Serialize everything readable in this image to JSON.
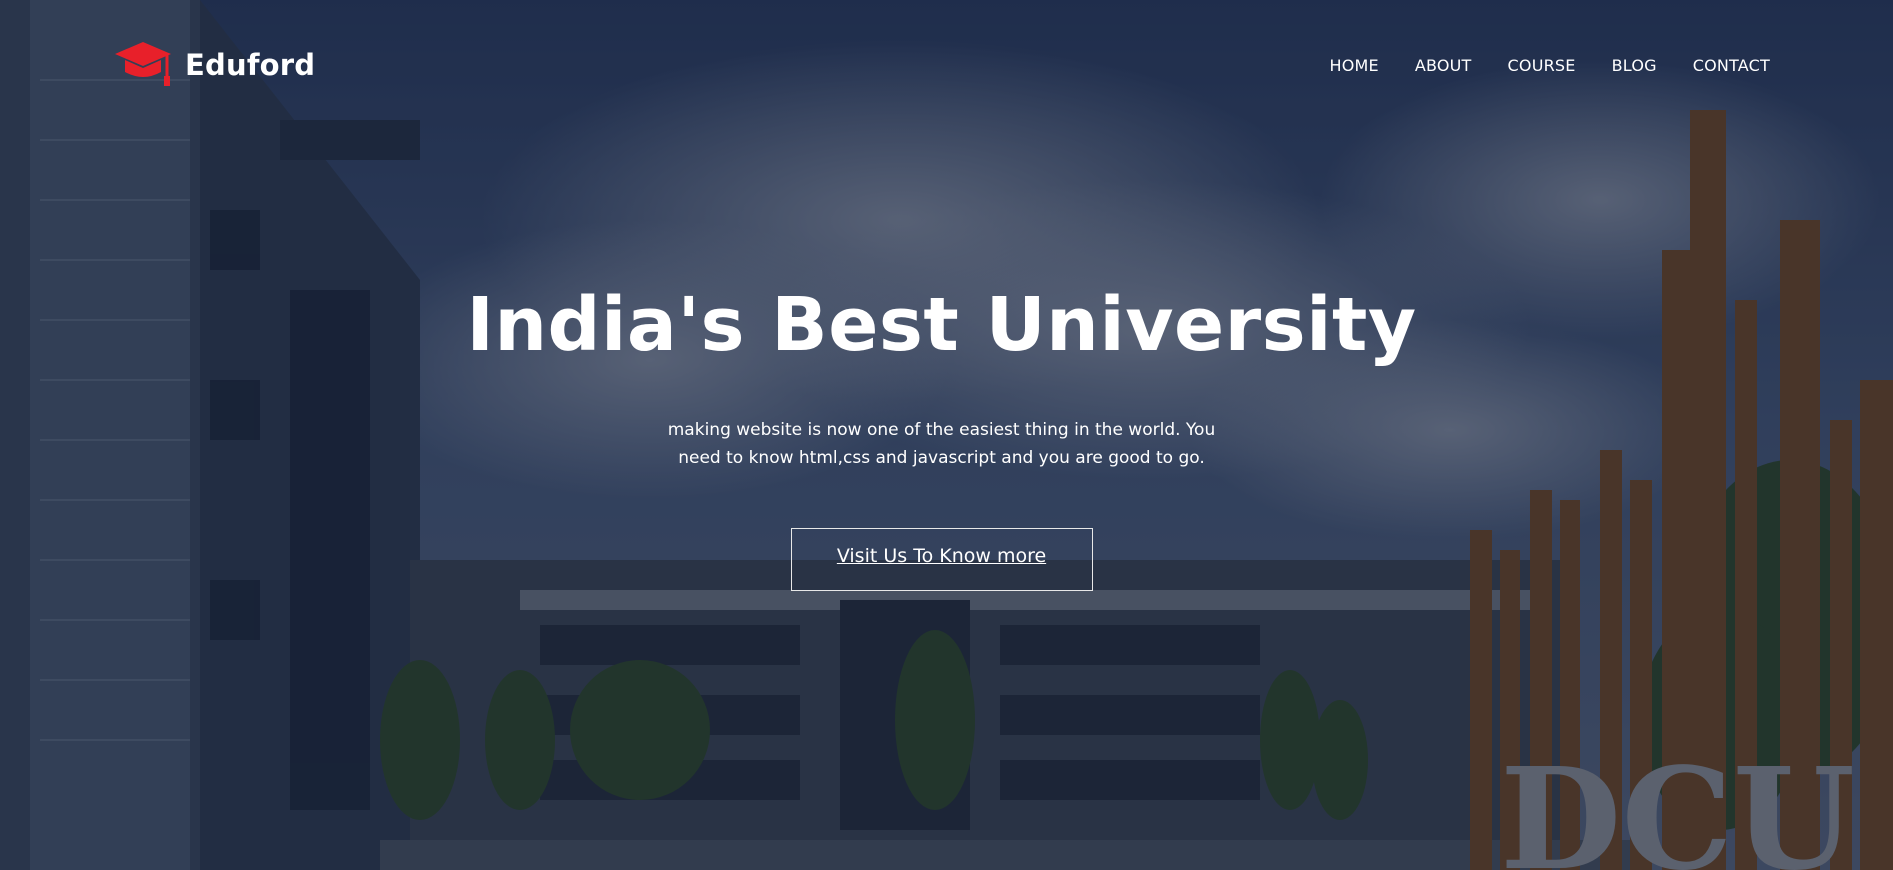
{
  "brand": {
    "name": "Eduford",
    "icon": "graduation-cap-icon",
    "accent": "#e8202a"
  },
  "nav": {
    "items": [
      {
        "label": "HOME"
      },
      {
        "label": "ABOUT"
      },
      {
        "label": "COURSE"
      },
      {
        "label": "BLOG"
      },
      {
        "label": "CONTACT"
      }
    ]
  },
  "hero": {
    "title": "India's Best University",
    "subtitle": "making website is now one of the easiest thing in the world. You need to know html,css and javascript and you are good to go.",
    "cta_label": "Visit Us To Know more",
    "sign_text": "DCU"
  }
}
